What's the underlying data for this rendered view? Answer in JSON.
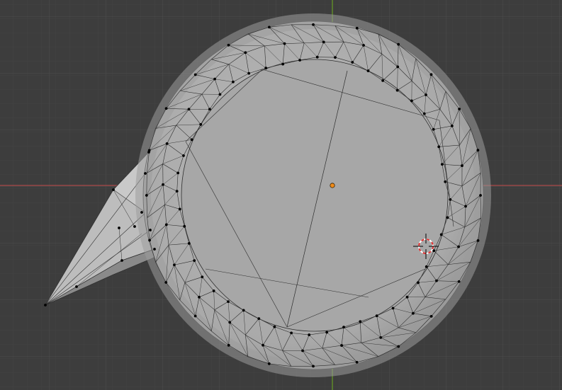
{
  "viewport": {
    "mode": "edit-mode",
    "view": "top-orthographic",
    "background": "#3d3d3d",
    "grid_minor_color": "#454545",
    "grid_major_color": "#505050",
    "x_axis_color": "#a0504f",
    "y_axis_color": "#5f8a2c"
  },
  "mesh": {
    "object_type": "mesh",
    "face_color": "#a8a8a8",
    "face_light_color": "#c4c4c4",
    "face_dark_color": "#8e8e8e",
    "edge_color": "#2e2e2e",
    "vertex_color": "#000000",
    "origin_color": "#f08c1a"
  },
  "cursor": {
    "name": "3d-cursor",
    "ring_color_a": "#e03030",
    "ring_color_b": "#ffffff"
  }
}
